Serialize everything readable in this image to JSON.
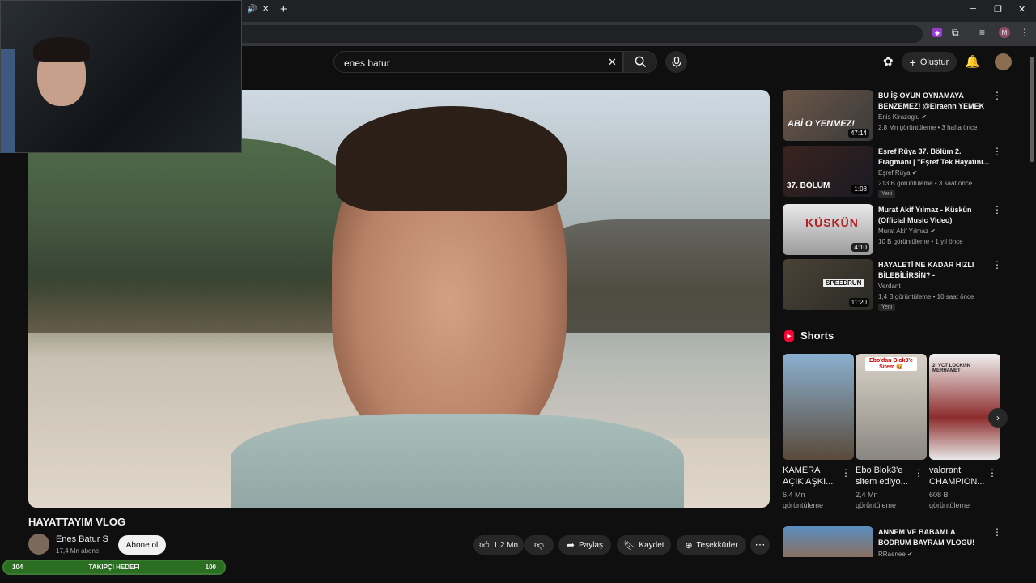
{
  "browser": {
    "new_tab_glyph": "+",
    "window_controls": [
      "─",
      "❐",
      "✕"
    ],
    "profile_initial": "M"
  },
  "header": {
    "search_value": "enes batur",
    "create_label": "Oluştur"
  },
  "video": {
    "title": "HAYATTAYIM VLOG",
    "channel": "Enes Batur S",
    "subscribers": "17,4 Mn abone",
    "subscribe_label": "Abone ol",
    "likes": "1,2 Mn",
    "share_label": "Paylaş",
    "save_label": "Kaydet",
    "thanks_label": "Teşekkürler"
  },
  "overlay": {
    "progress_left": "104",
    "progress_label": "TAKİPÇİ HEDEFİ",
    "progress_right": "100"
  },
  "recommendations": [
    {
      "title": "BU İŞ OYUN OYNAMAYA BENZEMEZ! @Elraenn YEMEK ...",
      "channel": "Enis Kirazoglu",
      "meta": "2,8 Mn görüntüleme • 3 hafta önce",
      "duration": "47:14",
      "badge": "",
      "thumb_text": "ABİ O YENMEZ!"
    },
    {
      "title": "Eşref Rüya 37. Bölüm 2. Fragmanı | \"Eşref Tek Hayatını...",
      "channel": "Eşref Rüya",
      "meta": "213 B görüntüleme • 3 saat önce",
      "duration": "1:08",
      "badge": "Yeni",
      "thumb_text": "37. BÖLÜM"
    },
    {
      "title": "Murat Akif Yılmaz - Küskün (Official Music Video)",
      "channel": "Murat Akif Yılmaz",
      "meta": "10 B görüntüleme • 1 yıl önce",
      "duration": "4:10",
      "badge": "",
      "thumb_text": "KÜSKÜN"
    },
    {
      "title": "HAYALETİ NE KADAR HIZLI BİLEBİLİRSİN? - Phasmophobi...",
      "channel": "Verdant",
      "meta": "1,4 B görüntüleme • 10 saat önce",
      "duration": "11:20",
      "badge": "Yeni",
      "thumb_text": "SPEEDRUN"
    }
  ],
  "shorts": {
    "heading": "Shorts",
    "items": [
      {
        "title": "KAMERA AÇIK AŞKI...",
        "views": "6,4 Mn",
        "views_label": "görüntüleme",
        "thumb_text": ""
      },
      {
        "title": "Ebo Blok3'e sitem ediyo...",
        "views": "2,4 Mn",
        "views_label": "görüntüleme",
        "thumb_text": "Ebo'dan Blok3'e Sitem 😡"
      },
      {
        "title": "valorant CHAMPION...",
        "views": "608 B",
        "views_label": "görüntüleme",
        "thumb_text": "2- VCT LOCK//IN MERHAMET"
      }
    ]
  },
  "bottom_rec": {
    "title": "ANNEM VE BABAMLA BODRUM BAYRAM VLOGU!",
    "channel": "RRaenee"
  },
  "colors": {
    "bg": "#0f0f0f",
    "accent_red": "#ff0033",
    "progress_green": "#2a6e22"
  }
}
